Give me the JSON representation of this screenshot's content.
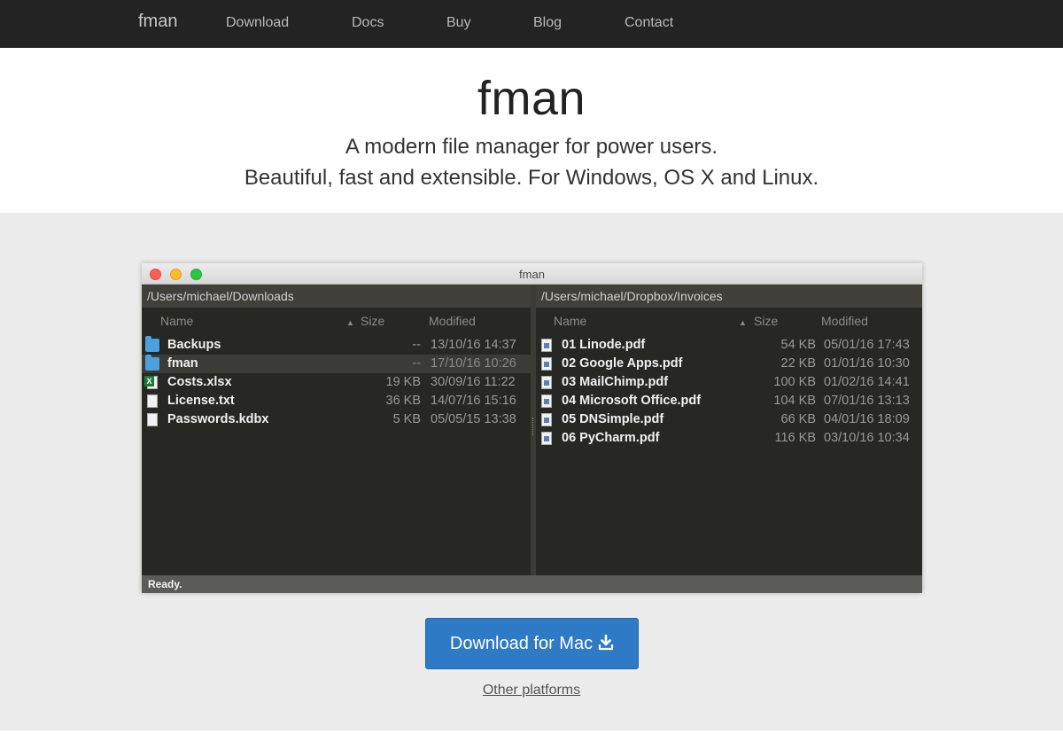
{
  "nav": {
    "brand": "fman",
    "links": [
      "Download",
      "Docs",
      "Buy",
      "Blog",
      "Contact"
    ]
  },
  "hero": {
    "title": "fman",
    "tagline": "A modern file manager for power users.",
    "subtagline": "Beautiful, fast and extensible. For Windows, OS X and Linux."
  },
  "window": {
    "title": "fman",
    "status": "Ready.",
    "columns": {
      "name": "Name",
      "size": "Size",
      "modified": "Modified"
    },
    "left": {
      "path": "/Users/michael/Downloads",
      "rows": [
        {
          "icon": "folder-icon",
          "name": "Backups",
          "size": "--",
          "modified": "13/10/16 14:37"
        },
        {
          "icon": "folder-icon",
          "name": "fman",
          "size": "--",
          "modified": "17/10/16 10:26",
          "selected": true
        },
        {
          "icon": "spreadsheet-icon",
          "name": "Costs.xlsx",
          "size": "19 KB",
          "modified": "30/09/16 11:22"
        },
        {
          "icon": "text-file-icon",
          "name": "License.txt",
          "size": "36 KB",
          "modified": "14/07/16 15:16"
        },
        {
          "icon": "file-icon",
          "name": "Passwords.kdbx",
          "size": "5 KB",
          "modified": "05/05/15 13:38"
        }
      ]
    },
    "right": {
      "path": "/Users/michael/Dropbox/Invoices",
      "rows": [
        {
          "icon": "pdf-icon",
          "name": "01 Linode.pdf",
          "size": "54 KB",
          "modified": "05/01/16 17:43"
        },
        {
          "icon": "pdf-icon",
          "name": "02 Google Apps.pdf",
          "size": "22 KB",
          "modified": "01/01/16 10:30"
        },
        {
          "icon": "pdf-icon",
          "name": "03 MailChimp.pdf",
          "size": "100 KB",
          "modified": "01/02/16 14:41"
        },
        {
          "icon": "pdf-icon",
          "name": "04 Microsoft Office.pdf",
          "size": "104 KB",
          "modified": "07/01/16 13:13"
        },
        {
          "icon": "pdf-icon",
          "name": "05 DNSimple.pdf",
          "size": "66 KB",
          "modified": "04/01/16 18:09"
        },
        {
          "icon": "pdf-icon",
          "name": "06 PyCharm.pdf",
          "size": "116 KB",
          "modified": "03/10/16 10:34"
        }
      ]
    }
  },
  "cta": {
    "download_label": "Download for Mac",
    "other_label": "Other platforms"
  },
  "colors": {
    "nav_bg": "#232323",
    "button_blue": "#2e7ac4",
    "folder_blue": "#4ba0dd",
    "pane_bg": "#272724"
  }
}
